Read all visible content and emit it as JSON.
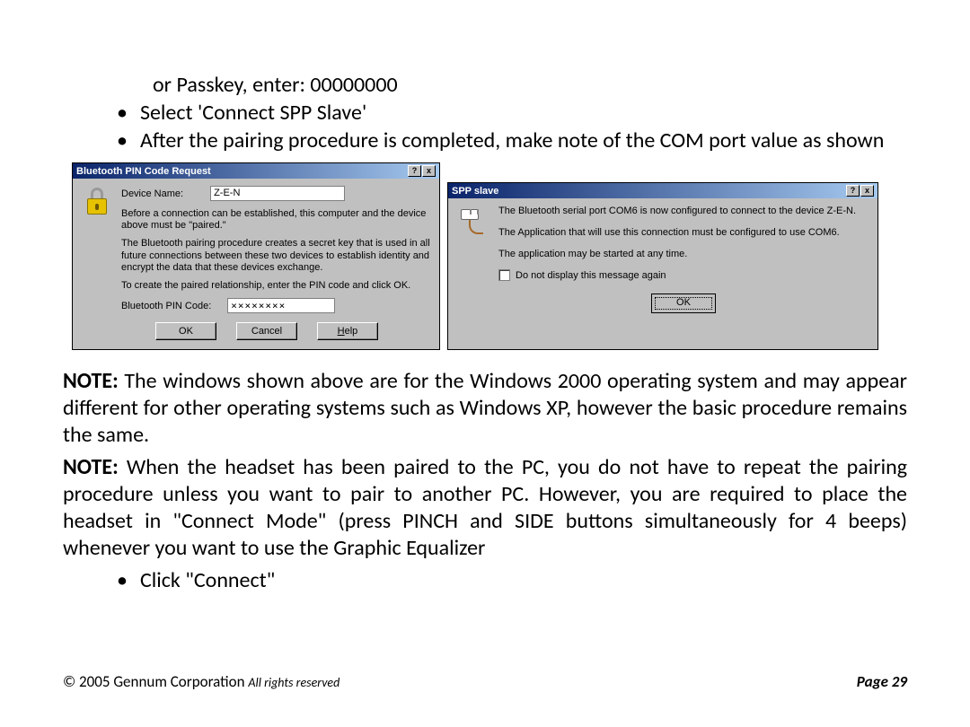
{
  "intro": {
    "passkey_line": "or Passkey, enter: 00000000"
  },
  "bullets_top": [
    "Select 'Connect SPP Slave'",
    "After the pairing procedure is completed, make note of the COM port value as shown"
  ],
  "dialog1": {
    "title": "Bluetooth PIN Code Request",
    "help_glyph": "?",
    "close_glyph": "x",
    "device_name_label": "Device Name:",
    "device_name_value": "Z-E-N",
    "para1": "Before a connection can be established, this computer and the device above must be \"paired.\"",
    "para2": "The Bluetooth pairing procedure creates a secret key that is used in all future connections between these two devices to establish identity and encrypt the data that these devices exchange.",
    "para3": "To create the paired relationship, enter the PIN code and click OK.",
    "pin_label": "Bluetooth PIN Code:",
    "pin_value": "××××××××",
    "ok": "OK",
    "cancel": "Cancel",
    "help": "Help",
    "help_u": "H"
  },
  "dialog2": {
    "title": "SPP slave",
    "help_glyph": "?",
    "close_glyph": "x",
    "para1": "The Bluetooth serial port COM6 is now configured to connect to the device Z-E-N.",
    "para2": "The Application that will use this connection must be configured to use COM6.",
    "para3": "The application may be started at any time.",
    "checkbox_label": "Do not display this message again",
    "ok": "OK"
  },
  "notes": {
    "note1_label": "NOTE:",
    "note1_text": "  The windows shown above are for the Windows 2000 operating system and may appear different for other operating systems such as Windows XP, however the basic procedure remains the same.",
    "note2_label": "NOTE:",
    "note2_text": "  When the headset has been paired to the PC, you do not have to repeat the pairing procedure unless you want to pair to another PC.  However, you are required to place the headset in \"Connect Mode\" (press PINCH and SIDE buttons simultaneously for 4 beeps) whenever you want to use the Graphic Equalizer"
  },
  "bullets_bottom": [
    "Click \"Connect\""
  ],
  "footer": {
    "copyright": "© 2005 Gennum Corporation ",
    "rights": "All rights reserved",
    "page": "Page 29"
  }
}
